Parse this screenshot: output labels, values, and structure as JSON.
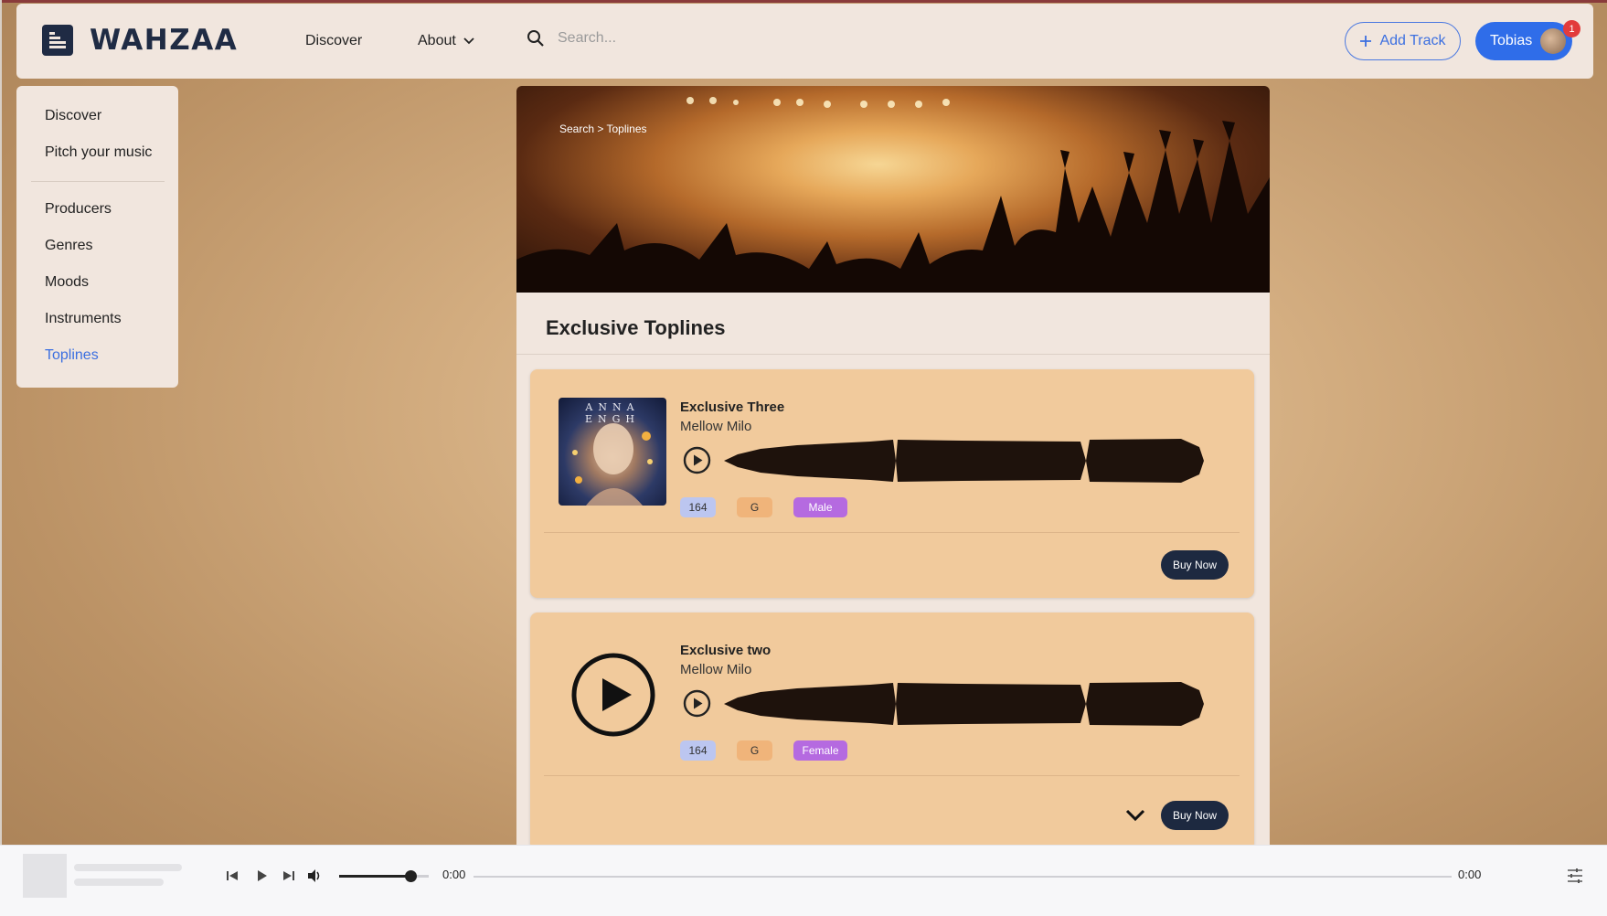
{
  "header": {
    "brand": "WAHZAA",
    "nav_discover": "Discover",
    "nav_about": "About",
    "search_placeholder": "Search...",
    "add_track_label": "Add Track",
    "user_name": "Tobias",
    "notification_count": "1"
  },
  "sidebar": {
    "items": [
      {
        "label": "Discover",
        "active": false
      },
      {
        "label": "Pitch your music",
        "active": false
      },
      {
        "label": "Producers",
        "active": false
      },
      {
        "label": "Genres",
        "active": false
      },
      {
        "label": "Moods",
        "active": false
      },
      {
        "label": "Instruments",
        "active": false
      },
      {
        "label": "Toplines",
        "active": true
      }
    ]
  },
  "main": {
    "breadcrumb": "Search > Toplines",
    "page_title": "Exclusive Toplines",
    "tracks": [
      {
        "title": "Exclusive Three",
        "artist": "Mellow Milo",
        "cover_text": "ANNA ENGH",
        "bpm": "164",
        "key": "G",
        "gender": "Male",
        "buy_label": "Buy Now"
      },
      {
        "title": "Exclusive two",
        "artist": "Mellow Milo",
        "bpm": "164",
        "key": "G",
        "gender": "Female",
        "buy_label": "Buy Now"
      }
    ]
  },
  "player": {
    "current_time": "0:00",
    "duration": "0:00",
    "volume": 0.8,
    "progress": 0
  },
  "colors": {
    "accent": "#2f6de9",
    "brand": "#1f2b44",
    "card": "#f1ca9c",
    "tag_bpm": "#bcc6f0",
    "tag_key": "#f0b47a",
    "tag_gender": "#b56ae0",
    "buy_button": "#1d2940"
  }
}
